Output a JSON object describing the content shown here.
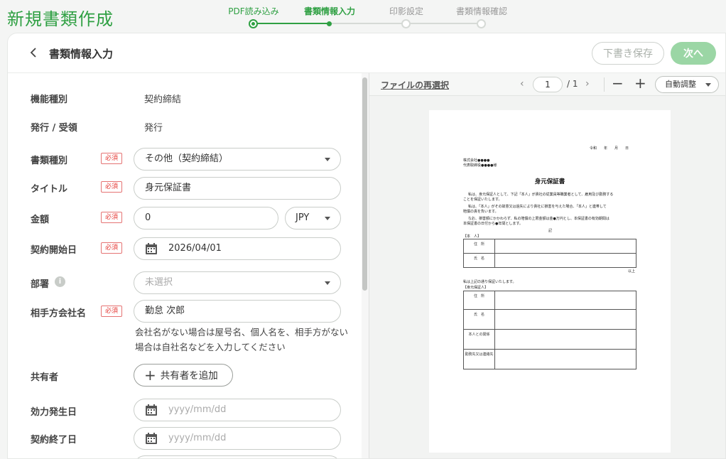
{
  "page_title": "新規書類作成",
  "steps": [
    {
      "label": "PDF読み込み",
      "state": "done"
    },
    {
      "label": "書類情報入力",
      "state": "current"
    },
    {
      "label": "印影設定",
      "state": "todo"
    },
    {
      "label": "書類情報確認",
      "state": "todo"
    }
  ],
  "header": {
    "title": "書類情報入力",
    "draft_label": "下書き保存",
    "next_label": "次へ"
  },
  "form": {
    "required_badge": "必須",
    "function_type": {
      "label": "機能種別",
      "value": "契約締結"
    },
    "issue_receive": {
      "label": "発行 / 受領",
      "value": "発行"
    },
    "doc_type": {
      "label": "書類種別",
      "value": "その他（契約締結）"
    },
    "title": {
      "label": "タイトル",
      "value": "身元保証書"
    },
    "amount": {
      "label": "金額",
      "value": "0",
      "currency": "JPY"
    },
    "contract_start": {
      "label": "契約開始日",
      "value": "2026/04/01"
    },
    "department": {
      "label": "部署",
      "placeholder": "未選択",
      "info": "i"
    },
    "counterparty": {
      "label": "相手方会社名",
      "value": "勤怠 次郎",
      "hint": "会社名がない場合は屋号名、個人名を、相手方がない場合は自社名などを入力してください"
    },
    "sharers": {
      "label": "共有者",
      "button": "共有者を追加"
    },
    "effective_date": {
      "label": "効力発生日",
      "placeholder": "yyyy/mm/dd"
    },
    "contract_end": {
      "label": "契約終了日",
      "placeholder": "yyyy/mm/dd"
    }
  },
  "viewer": {
    "reselect": "ファイルの再選択",
    "page_current": "1",
    "page_total": "/ 1",
    "zoom_mode": "自動調整"
  },
  "document": {
    "date_line": "令和　　年　　月　　日",
    "addressee_1": "株式会社●●●●",
    "addressee_2": "代表取締役●●●●様",
    "title": "身元保証書",
    "body_1": "私は、身元保証人として、下記「本人」が貴社の従業員等職業者として、雇用及び勤務する",
    "body_2": "ことを保証いたします。",
    "body_3": "私は、「本人」がその故意又は過失により貴社に損害を与えた場合、「本人」と連帯して",
    "body_4": "賠償の責を負います。",
    "body_5": "なお、損害額にかかわらず、私の賠償の上限金額は金●万円とし、本保証書の有効期間は",
    "body_6": "本保証書の日付から●年間とします。",
    "ki": "記",
    "section_person": "【本　人】",
    "addr_label": "住　所",
    "name_label": "氏　名",
    "ijou": "以上",
    "agree_line": "私は上記の通り保証いたします。",
    "section_guarantor": "【身元保証人】",
    "relation_label": "本人との関係",
    "phone_label": "勤務先又は連絡先"
  }
}
